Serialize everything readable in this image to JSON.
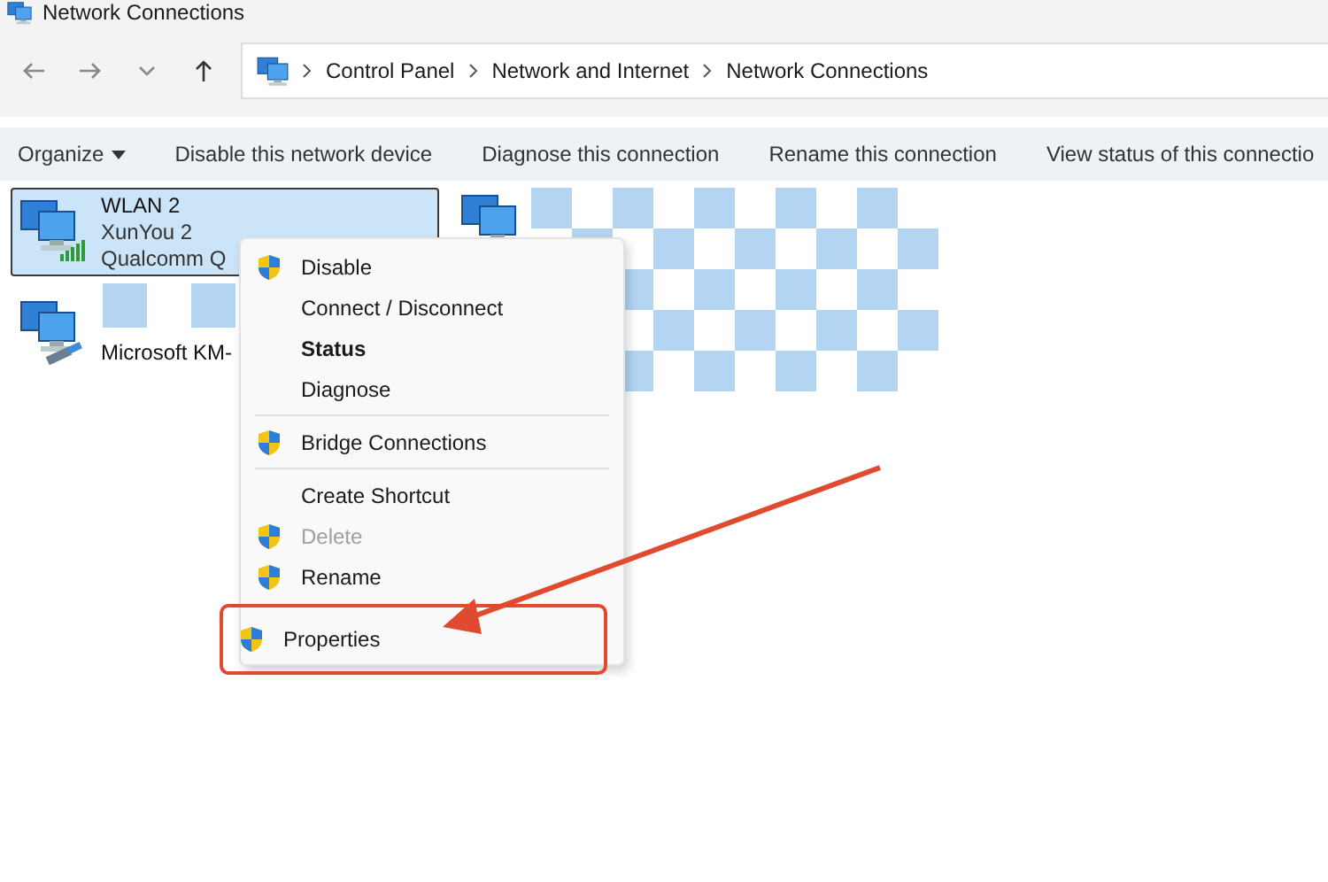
{
  "window": {
    "title": "Network Connections"
  },
  "address_bar": {
    "path": [
      "Control Panel",
      "Network and Internet",
      "Network Connections"
    ]
  },
  "command_bar": [
    {
      "label": "Organize",
      "dropdown": true
    },
    {
      "label": "Disable this network device",
      "dropdown": false
    },
    {
      "label": "Diagnose this connection",
      "dropdown": false
    },
    {
      "label": "Rename this connection",
      "dropdown": false
    },
    {
      "label": "View status of this connectio",
      "dropdown": false
    }
  ],
  "connections": [
    {
      "kind": "wireless",
      "selected": true,
      "lines": [
        "WLAN 2",
        "XunYou 2",
        "Qualcomm Q"
      ]
    },
    {
      "kind": "wired",
      "selected": false,
      "lines": [
        "Microsoft KM-"
      ]
    },
    {
      "kind": "plain",
      "selected": false
    }
  ],
  "context_menu": [
    {
      "kind": "item",
      "label": "Disable",
      "shield": true,
      "bold": false,
      "disabled": false
    },
    {
      "kind": "item",
      "label": "Connect / Disconnect",
      "shield": false,
      "bold": false,
      "disabled": false
    },
    {
      "kind": "item",
      "label": "Status",
      "shield": false,
      "bold": true,
      "disabled": false
    },
    {
      "kind": "item",
      "label": "Diagnose",
      "shield": false,
      "bold": false,
      "disabled": false
    },
    {
      "kind": "separator"
    },
    {
      "kind": "item",
      "label": "Bridge Connections",
      "shield": true,
      "bold": false,
      "disabled": false
    },
    {
      "kind": "separator"
    },
    {
      "kind": "item",
      "label": "Create Shortcut",
      "shield": false,
      "bold": false,
      "disabled": false
    },
    {
      "kind": "item",
      "label": "Delete",
      "shield": true,
      "bold": false,
      "disabled": true
    },
    {
      "kind": "item",
      "label": "Rename",
      "shield": true,
      "bold": false,
      "disabled": false
    },
    {
      "kind": "item",
      "label": "Properties",
      "shield": true,
      "bold": false,
      "disabled": false,
      "highlighted": true
    }
  ]
}
